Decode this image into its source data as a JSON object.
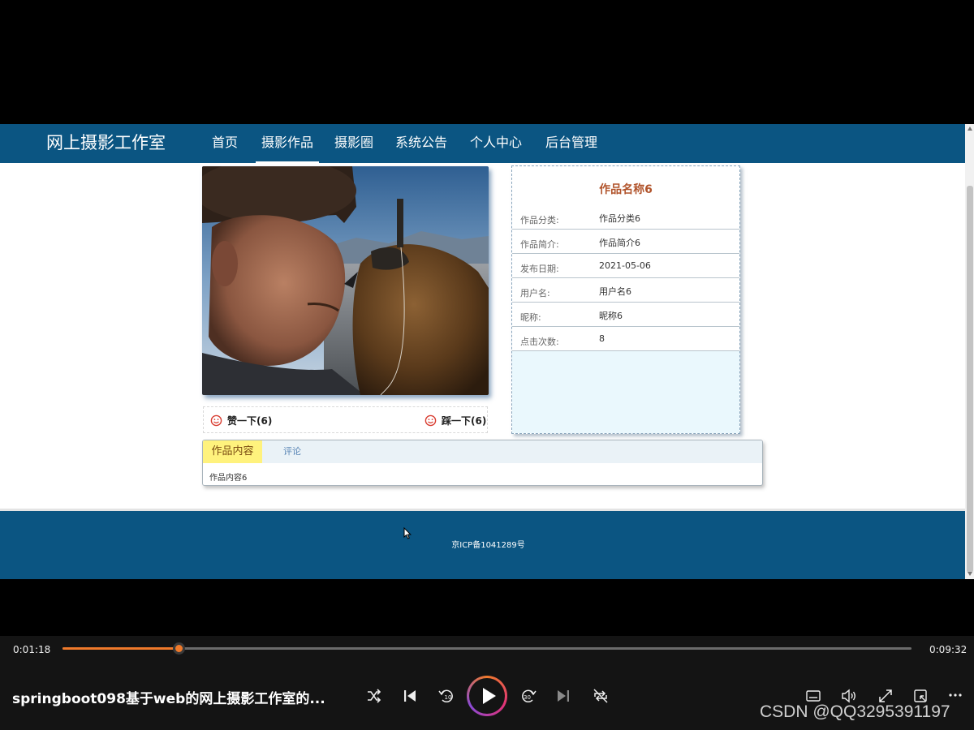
{
  "site": {
    "title": "网上摄影工作室",
    "nav": [
      {
        "label": "首页",
        "active": false
      },
      {
        "label": "摄影作品",
        "active": true
      },
      {
        "label": "摄影圈",
        "active": false
      },
      {
        "label": "系统公告",
        "active": false
      },
      {
        "label": "个人中心",
        "active": false
      },
      {
        "label": "后台管理",
        "active": false
      }
    ]
  },
  "work": {
    "title": "作品名称6",
    "fields": [
      {
        "label": "作品分类:",
        "value": "作品分类6"
      },
      {
        "label": "作品简介:",
        "value": "作品简介6"
      },
      {
        "label": "发布日期:",
        "value": "2021-05-06"
      },
      {
        "label": "用户名:",
        "value": "用户名6"
      },
      {
        "label": "昵称:",
        "value": "昵称6"
      },
      {
        "label": "点击次数:",
        "value": "8"
      }
    ],
    "like_label": "赞一下(6)",
    "dislike_label": "踩一下(6)"
  },
  "tabs": {
    "content_label": "作品内容",
    "comment_label": "评论",
    "content_text": "作品内容6"
  },
  "footer": {
    "icp": "京ICP备1041289号"
  },
  "player": {
    "current_time": "0:01:18",
    "total_time": "0:09:32",
    "progress": 0.1364,
    "video_title": "springboot098基于web的网上摄影工作室的...",
    "watermark": "CSDN @QQ3295391197"
  },
  "colors": {
    "nav_bg": "#0b5582",
    "accent": "#f07a2b",
    "title_color": "#b1542c",
    "tab_active_bg": "#fff27d"
  }
}
